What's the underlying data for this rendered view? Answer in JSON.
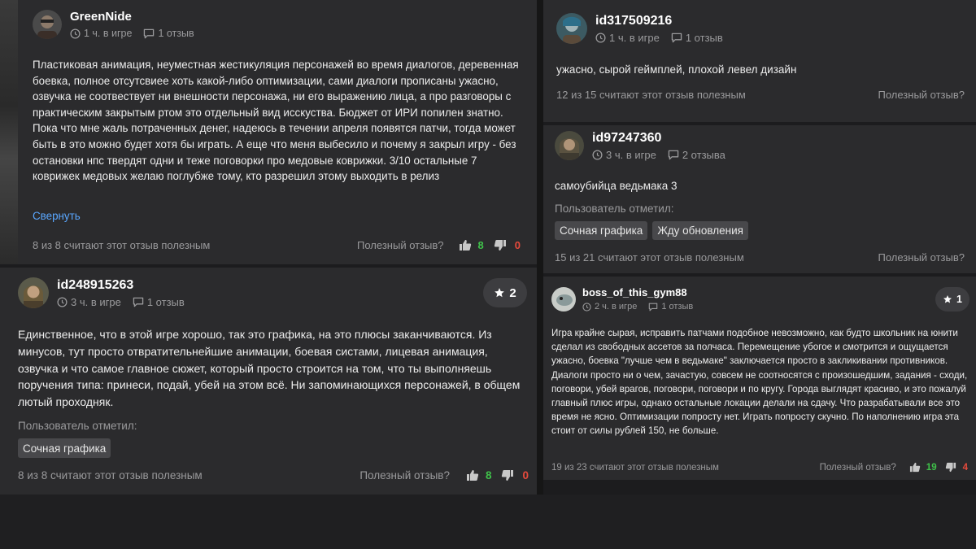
{
  "reviews": [
    {
      "username": "GreenNide",
      "playtime": "1 ч. в игре",
      "review_count": "1 отзыв",
      "text": "Пластиковая анимация, неуместная жестикуляция персонажей во время диалогов, деревенная боевка, полное отсутсвиее хоть какой-либо оптимизации, сами диалоги прописаны ужасно, озвучка не соотвествует ни внешности персонажа, ни его выражению лица, а про разговоры с практическим закрытым ртом это отдельный вид исскуства. Бюджет от ИРИ попилен знатно. Пока что мне жаль потраченных денег, надеюсь в течении апреля появятся патчи, тогда может быть в это можно будет хотя бы играть. А еще что меня выбесило и почему я закрыл игру - без остановки нпс твердят одни и теже поговорки про медовые коврижки. 3/10 остальные 7 коврижек медовых желаю поглубже тому, кто разрешил этому выходить в релиз",
      "collapse_label": "Свернуть",
      "helpful_stat": "8 из 8 считают этот отзыв полезным",
      "helpful_question": "Полезный отзыв?",
      "likes": "8",
      "dislikes": "0"
    },
    {
      "username": "id317509216",
      "playtime": "1 ч. в игре",
      "review_count": "1 отзыв",
      "text": "ужасно, сырой геймплей, плохой левел дизайн",
      "helpful_stat": "12 из 15 считают этот отзыв полезным",
      "helpful_question": "Полезный отзыв?"
    },
    {
      "username": "id97247360",
      "playtime": "3 ч. в игре",
      "review_count": "2 отзыва",
      "text": "самоубийца ведьмака 3",
      "tags_label": "Пользователь отметил:",
      "tags": [
        "Сочная графика",
        "Жду обновления"
      ],
      "helpful_stat": "15 из 21 считают этот отзыв полезным",
      "helpful_question": "Полезный отзыв?"
    },
    {
      "username": "id248915263",
      "playtime": "3 ч. в игре",
      "review_count": "1 отзыв",
      "stars": "2",
      "text": "Единственное, что в этой игре хорошо, так это графика, на это плюсы заканчиваются. Из минусов, тут просто отвратительнейшие анимации, боевая систами, лицевая анимация, озвучка и что самое главное сюжет, который просто строится на том, что ты выполняешь поручения типа: принеси, подай, убей на этом всё. Ни запоминающихся персонажей, в общем лютый проходняк.",
      "tags_label": "Пользователь отметил:",
      "tags": [
        "Сочная графика"
      ],
      "helpful_stat": "8 из 8 считают этот отзыв полезным",
      "helpful_question": "Полезный отзыв?",
      "likes": "8",
      "dislikes": "0"
    },
    {
      "username": "boss_of_this_gym88",
      "playtime": "2 ч. в игре",
      "review_count": "1 отзыв",
      "stars": "1",
      "text": "Игра крайне сырая, исправить патчами подобное невозможно, как будто школьник на юнити сделал из свободных ассетов за полчаса. Перемещение убогое и смотрится и ощущается ужасно, боевка \"лучше чем в ведьмаке\" заключается просто в закликивании противников. Диалоги просто ни о чем, зачастую, совсем не соотносятся с произошедшим, задания - сходи, поговори, убей врагов, поговори, поговори и по кругу. Города выглядят красиво, и это пожалуй главный плюс игры, однако остальные локации делали на сдачу. Что разрабатывали все это время не ясно. Оптимизации попросту нет. Играть попросту скучно. По наполнению игра эта стоит от силы рублей 150, не больше.",
      "helpful_stat": "19 из 23 считают этот отзыв полезным",
      "helpful_question": "Полезный отзыв?",
      "likes": "19",
      "dislikes": "4"
    }
  ],
  "icons": {
    "clock": "clock-icon",
    "comment": "comment-icon",
    "thumb_up": "thumbs-up-icon",
    "thumb_down": "thumbs-down-icon",
    "star": "star-icon"
  },
  "colors": {
    "card_bg": "#2b2b2d",
    "link": "#5aa7ff",
    "like_green": "#3fc14a",
    "dislike_red": "#e64a3c",
    "tag_bg": "#48484b"
  }
}
